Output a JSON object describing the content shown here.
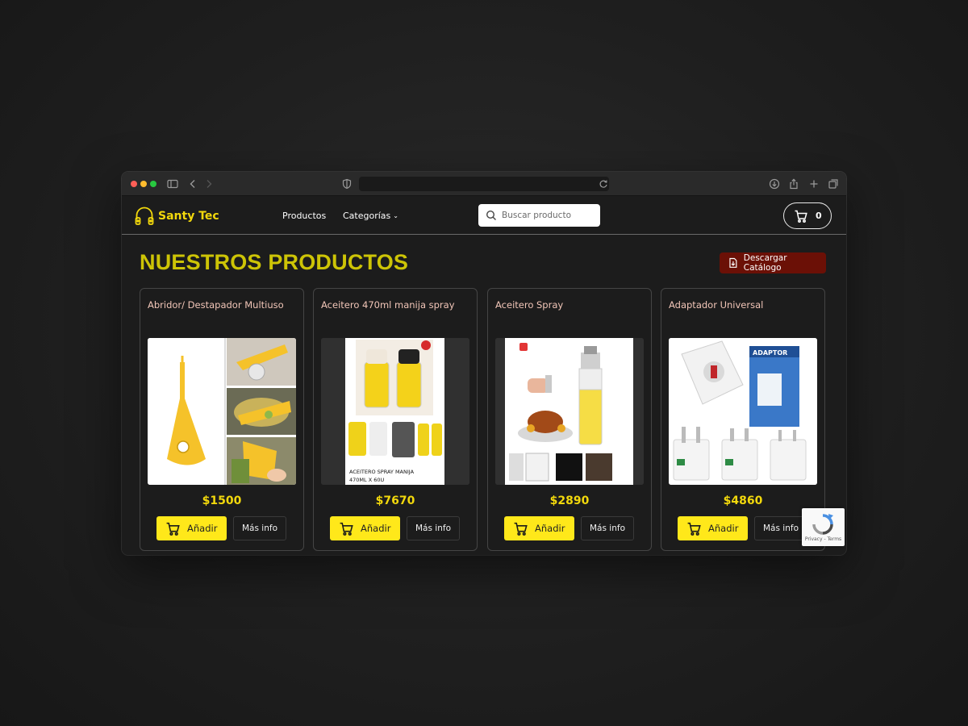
{
  "brand": {
    "name": "Santy Tec",
    "accent": "#f2d80c"
  },
  "nav": {
    "products_label": "Productos",
    "categories_label": "Categorías",
    "search_placeholder": "Buscar producto",
    "cart_count": "0"
  },
  "main": {
    "title": "NUESTROS PRODUCTOS",
    "download_label": "Descargar Catálogo"
  },
  "products": [
    {
      "name": "Abridor/ Destapador Multiuso",
      "price": "$1500",
      "add_label": "Añadir",
      "info_label": "Más info"
    },
    {
      "name": "Aceitero 470ml manija spray",
      "price": "$7670",
      "add_label": "Añadir",
      "info_label": "Más info",
      "image_caption_1": "ACEITERO SPRAY MANIJA",
      "image_caption_2": "470ML X 60U"
    },
    {
      "name": "Aceitero Spray",
      "price": "$2890",
      "add_label": "Añadir",
      "info_label": "Más info"
    },
    {
      "name": "Adaptador Universal",
      "price": "$4860",
      "add_label": "Añadir",
      "info_label": "Más info",
      "image_caption_1": "ADAPTOR"
    }
  ],
  "recaptcha": {
    "text": "Privacy - Terms"
  }
}
